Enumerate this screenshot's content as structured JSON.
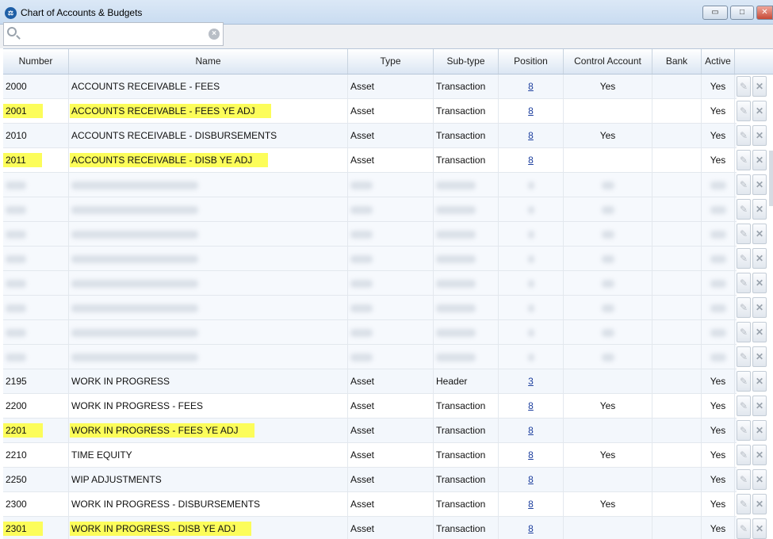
{
  "window": {
    "title": "Chart of Accounts & Budgets",
    "controls": {
      "minimize": "▭",
      "maximize": "□",
      "close": "✕"
    }
  },
  "search": {
    "value": "",
    "placeholder": ""
  },
  "grid": {
    "columns": [
      "Number",
      "Name",
      "Type",
      "Sub-type",
      "Position",
      "Control Account",
      "Bank",
      "Active"
    ],
    "rows_top": [
      {
        "number": "2000",
        "name": "ACCOUNTS RECEIVABLE - FEES",
        "type": "Asset",
        "subtype": "Transaction",
        "position": "8",
        "control": "Yes",
        "bank": "",
        "active": "Yes",
        "highlight": false
      },
      {
        "number": "2001",
        "name": "ACCOUNTS RECEIVABLE - FEES YE ADJ",
        "type": "Asset",
        "subtype": "Transaction",
        "position": "8",
        "control": "",
        "bank": "",
        "active": "Yes",
        "highlight": true
      },
      {
        "number": "2010",
        "name": "ACCOUNTS RECEIVABLE - DISBURSEMENTS",
        "type": "Asset",
        "subtype": "Transaction",
        "position": "8",
        "control": "Yes",
        "bank": "",
        "active": "Yes",
        "highlight": false
      },
      {
        "number": "2011",
        "name": "ACCOUNTS RECEIVABLE - DISB YE ADJ",
        "type": "Asset",
        "subtype": "Transaction",
        "position": "8",
        "control": "",
        "bank": "",
        "active": "Yes",
        "highlight": true
      }
    ],
    "rows_bottom": [
      {
        "number": "2195",
        "name": "WORK IN PROGRESS",
        "type": "Asset",
        "subtype": "Header",
        "position": "3",
        "control": "",
        "bank": "",
        "active": "Yes",
        "highlight": false
      },
      {
        "number": "2200",
        "name": "WORK IN PROGRESS - FEES",
        "type": "Asset",
        "subtype": "Transaction",
        "position": "8",
        "control": "Yes",
        "bank": "",
        "active": "Yes",
        "highlight": false
      },
      {
        "number": "2201",
        "name": "WORK IN PROGRESS - FEES YE ADJ",
        "type": "Asset",
        "subtype": "Transaction",
        "position": "8",
        "control": "",
        "bank": "",
        "active": "Yes",
        "highlight": true
      },
      {
        "number": "2210",
        "name": "TIME EQUITY",
        "type": "Asset",
        "subtype": "Transaction",
        "position": "8",
        "control": "Yes",
        "bank": "",
        "active": "Yes",
        "highlight": false
      },
      {
        "number": "2250",
        "name": "WIP ADJUSTMENTS",
        "type": "Asset",
        "subtype": "Transaction",
        "position": "8",
        "control": "",
        "bank": "",
        "active": "Yes",
        "highlight": false
      },
      {
        "number": "2300",
        "name": "WORK IN PROGRESS - DISBURSEMENTS",
        "type": "Asset",
        "subtype": "Transaction",
        "position": "8",
        "control": "Yes",
        "bank": "",
        "active": "Yes",
        "highlight": false
      },
      {
        "number": "2301",
        "name": "WORK IN PROGRESS - DISB YE ADJ",
        "type": "Asset",
        "subtype": "Transaction",
        "position": "8",
        "control": "",
        "bank": "",
        "active": "Yes",
        "highlight": true
      }
    ],
    "blurred_row_count": 8,
    "icons": {
      "edit": "edit-icon",
      "delete": "delete-icon"
    },
    "highlight_color": "#fcfd5a"
  }
}
